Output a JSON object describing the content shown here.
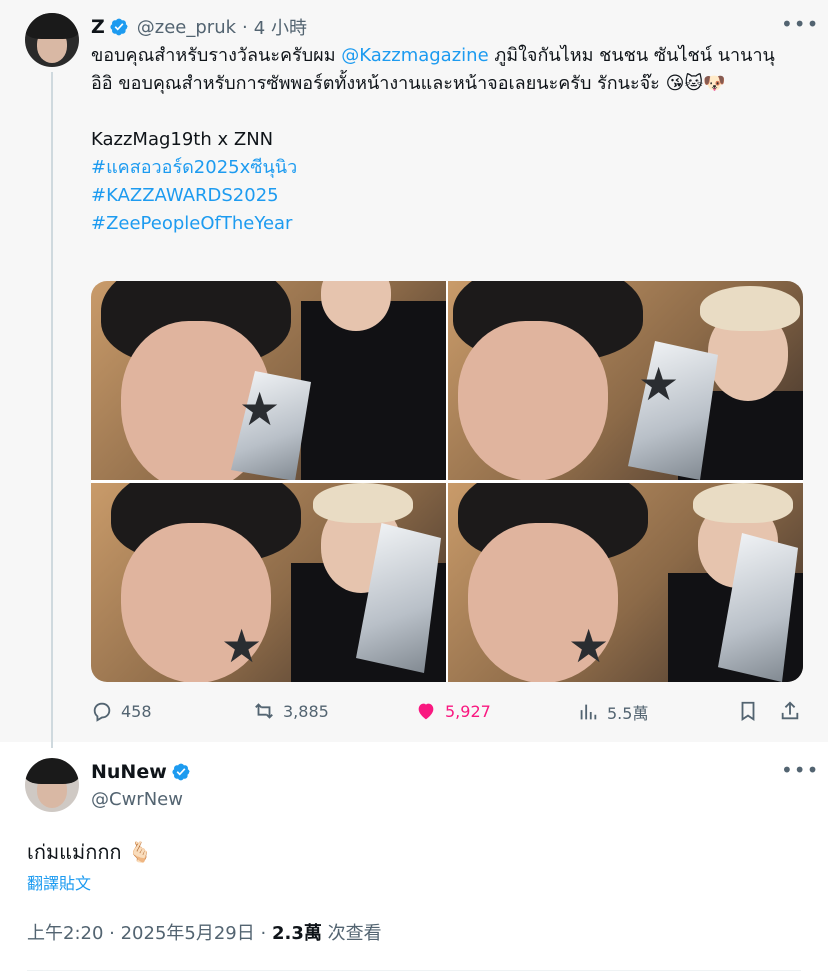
{
  "parent_tweet": {
    "author_name": "Z",
    "handle": "@zee_pruk",
    "separator": "·",
    "time": "4 小時",
    "text_line1_a": "ขอบคุณสำหรับรางวัลนะครับผม ",
    "mention": "@Kazzmagazine",
    "text_line1_b": " ภูมิใจกันไหม ชนชน ซันไชน์ นานานุ อิอิ ขอบคุณสำหรับการซัพพอร์ตทั้งหน้างานและหน้าจอเลยนะครับ รักนะจ๊ะ 😘🐱🐶",
    "text_line2": "KazzMag19th x ZNN",
    "hashtags": [
      "#แคสอวอร์ด2025xซีนุนิว",
      "#KAZZAWARDS2025",
      "#ZeePeopleOfTheYear"
    ],
    "stats": {
      "replies": "458",
      "retweets": "3,885",
      "likes": "5,927",
      "views": "5.5萬"
    }
  },
  "reply_tweet": {
    "author_name": "NuNew",
    "handle": "@CwrNew",
    "text": "เก่มแม่กกก 🫰🏻",
    "translate_label": "翻譯貼文",
    "time": "上午2:20 · 2025年5月29日",
    "separator": "·",
    "views_count": "2.3萬",
    "views_label": "次查看"
  },
  "colors": {
    "accent": "#1d9bf0",
    "like": "#f91880",
    "secondary_text": "#536471",
    "text": "#0f1419"
  }
}
